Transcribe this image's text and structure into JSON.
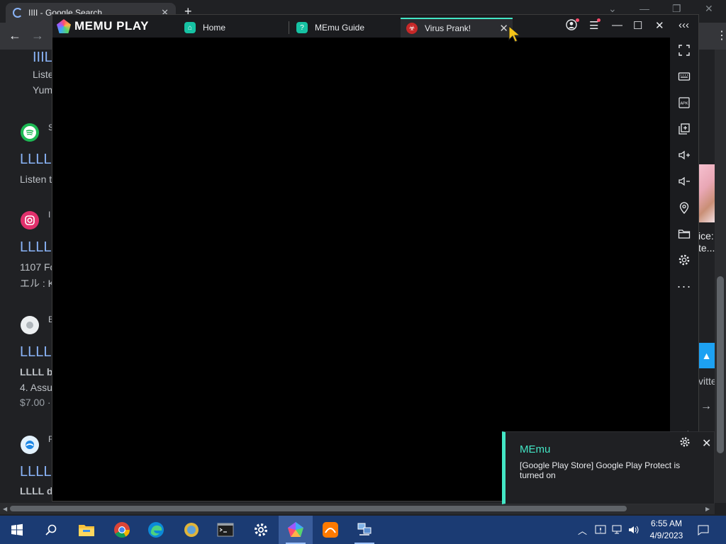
{
  "chrome": {
    "tab_title": "IIII - Google Search",
    "new_tab": "+",
    "tab_close": "✕",
    "win_min": "—",
    "win_restore": "❐",
    "win_close": "✕",
    "back": "←",
    "forward": "→"
  },
  "serp": {
    "r0_title": "IIIL",
    "r0_snip1": "Liste",
    "r0_snip2": "Yum",
    "r1_site": "S",
    "r1_title": "LLLL",
    "r1_snip": "Listen t",
    "r2_site": "I",
    "r2_title": "LLLL",
    "r2_snip1": "1107 Fo",
    "r2_snip2": "エル : K",
    "r3_site": "E",
    "r3_title": "LLLL",
    "r3_snip1": "LLLL b",
    "r3_snip2": "4. Assu",
    "r3_snip3": "$7.00 ·",
    "r4_site": "F",
    "r4_title": "LLLL",
    "r4_snip": "LLLL d",
    "right_1": "ice:",
    "right_2": "te...",
    "right_3": "vitte"
  },
  "memu": {
    "logo": "MEMU PLAY",
    "tabs": [
      {
        "label": "Home"
      },
      {
        "label": "MEmu Guide"
      },
      {
        "label": "Virus Prank!"
      }
    ],
    "tab_close": "✕",
    "ctl_menu": "☰",
    "ctl_min": "—",
    "ctl_max": "☐",
    "ctl_close": "✕",
    "ctl_collapse": "‹‹‹",
    "side_more": "···"
  },
  "notification": {
    "title": "MEmu",
    "body": "[Google Play Store] Google Play Protect is turned on"
  },
  "taskbar": {
    "time": "6:55 AM",
    "date": "4/9/2023"
  }
}
